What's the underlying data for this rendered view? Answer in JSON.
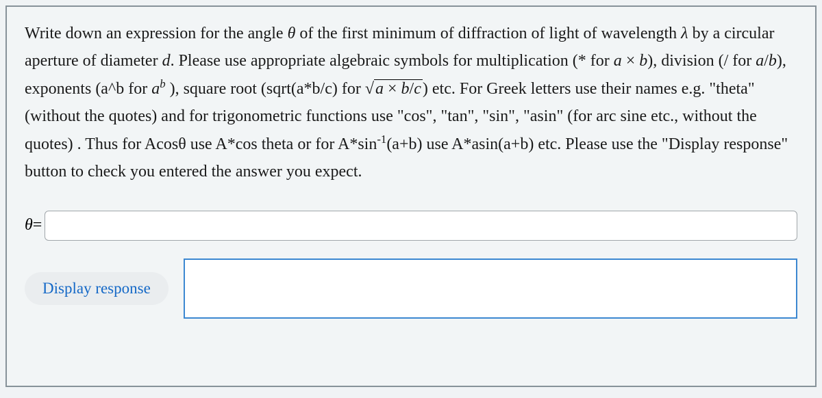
{
  "prompt": {
    "p1_pre": "Write down an expression for the angle ",
    "theta": "θ",
    "p1_post": " of the first minimum of diffraction of light of wavelength ",
    "lambda": "λ",
    "p2_pre": " by a circular aperture of diameter ",
    "d_var": "d",
    "p2_post": ". Please use appropriate algebraic symbols for multiplication (* for ",
    "a_var1": "a",
    "times1": " × ",
    "b_var1": "b",
    "p3": "), division (/ for ",
    "a_var2": "a",
    "slash": "/",
    "b_var2": "b",
    "p4": "), exponents (a^b for ",
    "a_var3": "a",
    "b_sup": "b",
    "p5": " ), square root (sqrt(a*b/c) for ",
    "sqrt_sym": "√",
    "sqrt_a": "a",
    "sqrt_times": " × ",
    "sqrt_b": "b",
    "sqrt_slash": "/",
    "sqrt_c": "c",
    "p6": ")  etc. For Greek letters use their names e.g. \"theta\" (without the quotes) and for  trigonometric functions use \"cos\", \"tan\", \"sin\",  \"asin\" (for arc sine etc., without the quotes) . Thus for Acosθ use A*cos theta or for A*sin",
    "neg1": "-1",
    "p7": "(a+b) use A*asin(a+b) etc. Please use the \"Display response\" button to check you entered the answer you expect."
  },
  "answer": {
    "label_theta": "θ",
    "label_eq": "=",
    "value": ""
  },
  "buttons": {
    "display_response": "Display response"
  }
}
